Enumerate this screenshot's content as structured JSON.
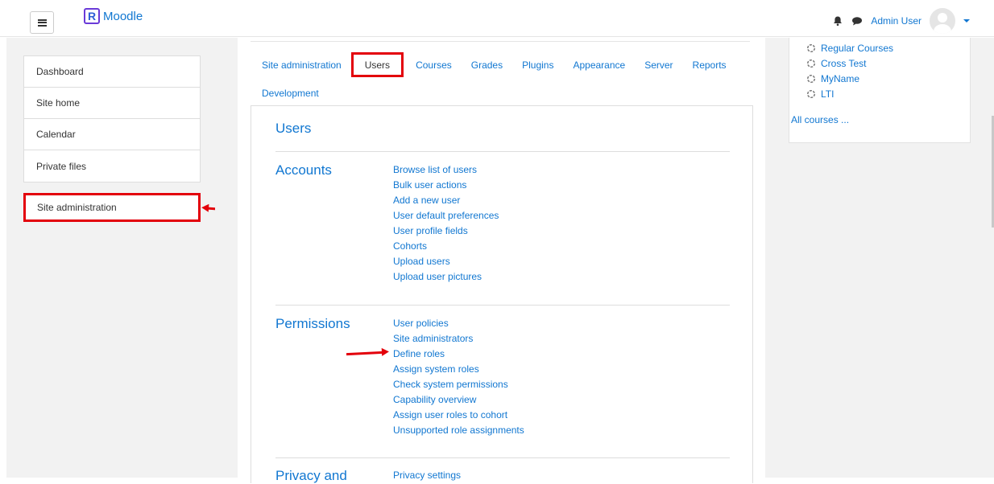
{
  "brand": {
    "logo_letter": "R",
    "name": "Moodle"
  },
  "user": {
    "name": "Admin User"
  },
  "drawer": {
    "items": [
      {
        "label": "Dashboard"
      },
      {
        "label": "Site home"
      },
      {
        "label": "Calendar"
      },
      {
        "label": "Private files"
      }
    ],
    "site_admin": "Site administration"
  },
  "tabs": [
    {
      "label": "Site administration",
      "active": false
    },
    {
      "label": "Users",
      "active": true
    },
    {
      "label": "Courses",
      "active": false
    },
    {
      "label": "Grades",
      "active": false
    },
    {
      "label": "Plugins",
      "active": false
    },
    {
      "label": "Appearance",
      "active": false
    },
    {
      "label": "Server",
      "active": false
    },
    {
      "label": "Reports",
      "active": false
    },
    {
      "label": "Development",
      "active": false
    }
  ],
  "main": {
    "title": "Users",
    "sections": [
      {
        "name": "Accounts",
        "links": [
          "Browse list of users",
          "Bulk user actions",
          "Add a new user",
          "User default preferences",
          "User profile fields",
          "Cohorts",
          "Upload users",
          "Upload user pictures"
        ]
      },
      {
        "name": "Permissions",
        "links": [
          "User policies",
          "Site administrators",
          "Define roles",
          "Assign system roles",
          "Check system permissions",
          "Capability overview",
          "Assign user roles to cohort",
          "Unsupported role assignments"
        ]
      },
      {
        "name": "Privacy and",
        "links": [
          "Privacy settings"
        ]
      }
    ]
  },
  "courses": {
    "items": [
      "Regular Courses",
      "Cross Test",
      "MyName",
      "LTI"
    ],
    "all_courses": "All courses ..."
  },
  "colors": {
    "link": "#1177d1",
    "highlight": "#e3000b",
    "background": "#f2f2f2"
  },
  "icons": [
    "menu-icon",
    "bell-icon",
    "chat-icon",
    "avatar-icon",
    "caret-down-icon",
    "course-icon"
  ]
}
